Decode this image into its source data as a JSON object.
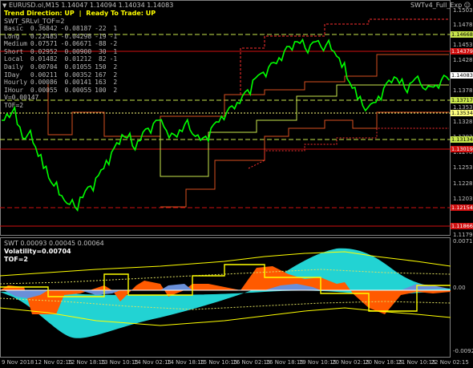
{
  "window": {
    "symbol_title": "EURUSD.ol,M15  1.14047 1.14094 1.14034 1.14083",
    "expert_label": "SWTv4_Full_Exp"
  },
  "header": {
    "trend_label": "Trend Direction:",
    "trend_value": "UP",
    "ready_label": "Ready To Trade:",
    "ready_value": "UP",
    "indicator_name": "SWT_SRLvl_TOF=2"
  },
  "table": [
    {
      "name": "Basic",
      "v1": "0.36842",
      "v2": "-0.08187",
      "v3": "-22",
      "v4": "1"
    },
    {
      "name": "Long",
      "v1": "0.22483",
      "v2": "-0.04298",
      "v3": "-19",
      "v4": "-1"
    },
    {
      "name": "Medium",
      "v1": "0.07571",
      "v2": "-0.06671",
      "v3": "-88",
      "v4": "-2"
    },
    {
      "name": "Short",
      "v1": "0.02952",
      "v2": "0.00900",
      "v3": "30",
      "v4": "1"
    },
    {
      "name": "Local",
      "v1": "0.01482",
      "v2": "0.01212",
      "v3": "82",
      "v4": "-1"
    },
    {
      "name": "Daily",
      "v1": "0.00704",
      "v2": "0.01055",
      "v3": "150",
      "v4": "2"
    },
    {
      "name": "IDay",
      "v1": "0.00211",
      "v2": "0.00352",
      "v3": "167",
      "v4": "2"
    },
    {
      "name": "Hourly",
      "v1": "0.00086",
      "v2": "0.00141",
      "v3": "163",
      "v4": "2"
    },
    {
      "name": "IHour",
      "v1": "0.00055",
      "v2": "0.00055",
      "v3": "100",
      "v4": "2"
    }
  ],
  "extra": {
    "v_line": "V=0.00147",
    "tof_line": "TOF=2"
  },
  "price_axis": {
    "ticks": [
      "1.15035",
      "1.14785",
      "1.14535",
      "1.14285",
      "1.14035",
      "1.13785",
      "1.13535",
      "1.13285",
      "1.13035",
      "1.12785",
      "1.12535",
      "1.12285",
      "1.12035",
      "1.11790"
    ],
    "tags": [
      {
        "text": "1.14668",
        "color": "#c8e64c",
        "text_color": "#000"
      },
      {
        "text": "1.14379",
        "color": "#d01010",
        "text_color": "#fff"
      },
      {
        "text": "1.14083",
        "color": "#ffffff",
        "text_color": "#000"
      },
      {
        "text": "1.13717",
        "color": "#c8e64c",
        "text_color": "#000"
      },
      {
        "text": "1.13534",
        "color": "#ffff80",
        "text_color": "#000"
      },
      {
        "text": "1.13134",
        "color": "#c8e64c",
        "text_color": "#000"
      },
      {
        "text": "1.13019",
        "color": "#d01010",
        "text_color": "#fff"
      },
      {
        "text": "1.12154",
        "color": "#d01010",
        "text_color": "#fff"
      },
      {
        "text": "1.11866",
        "color": "#d01010",
        "text_color": "#fff"
      }
    ]
  },
  "indicator": {
    "title": "SWT 0.00093 0.00045 0.00064",
    "volatility": "Volatility=0.00704",
    "tof": "TOF=2",
    "axis_ticks": [
      "0.00719",
      "0.00",
      "-0.00929"
    ]
  },
  "time_axis": [
    "9 Nov 2018",
    "12 Nov 02:15",
    "12 Nov 18:15",
    "13 Nov 10:15",
    "14 Nov 02:15",
    "14 Nov 18:15",
    "15 Nov 10:15",
    "16 Nov 02:15",
    "16 Nov 18:15",
    "19 Nov 10:15",
    "20 Nov 02:15",
    "20 Nov 18:15",
    "21 Nov 10:15",
    "22 Nov 02:15"
  ],
  "colors": {
    "price": "#00ff00",
    "up_text": "#ffff00",
    "fill_orange": "#ff5a00",
    "fill_cyan": "#22d3d3",
    "fill_blue": "#6a8fd8",
    "yellow_line": "#ffff00"
  }
}
